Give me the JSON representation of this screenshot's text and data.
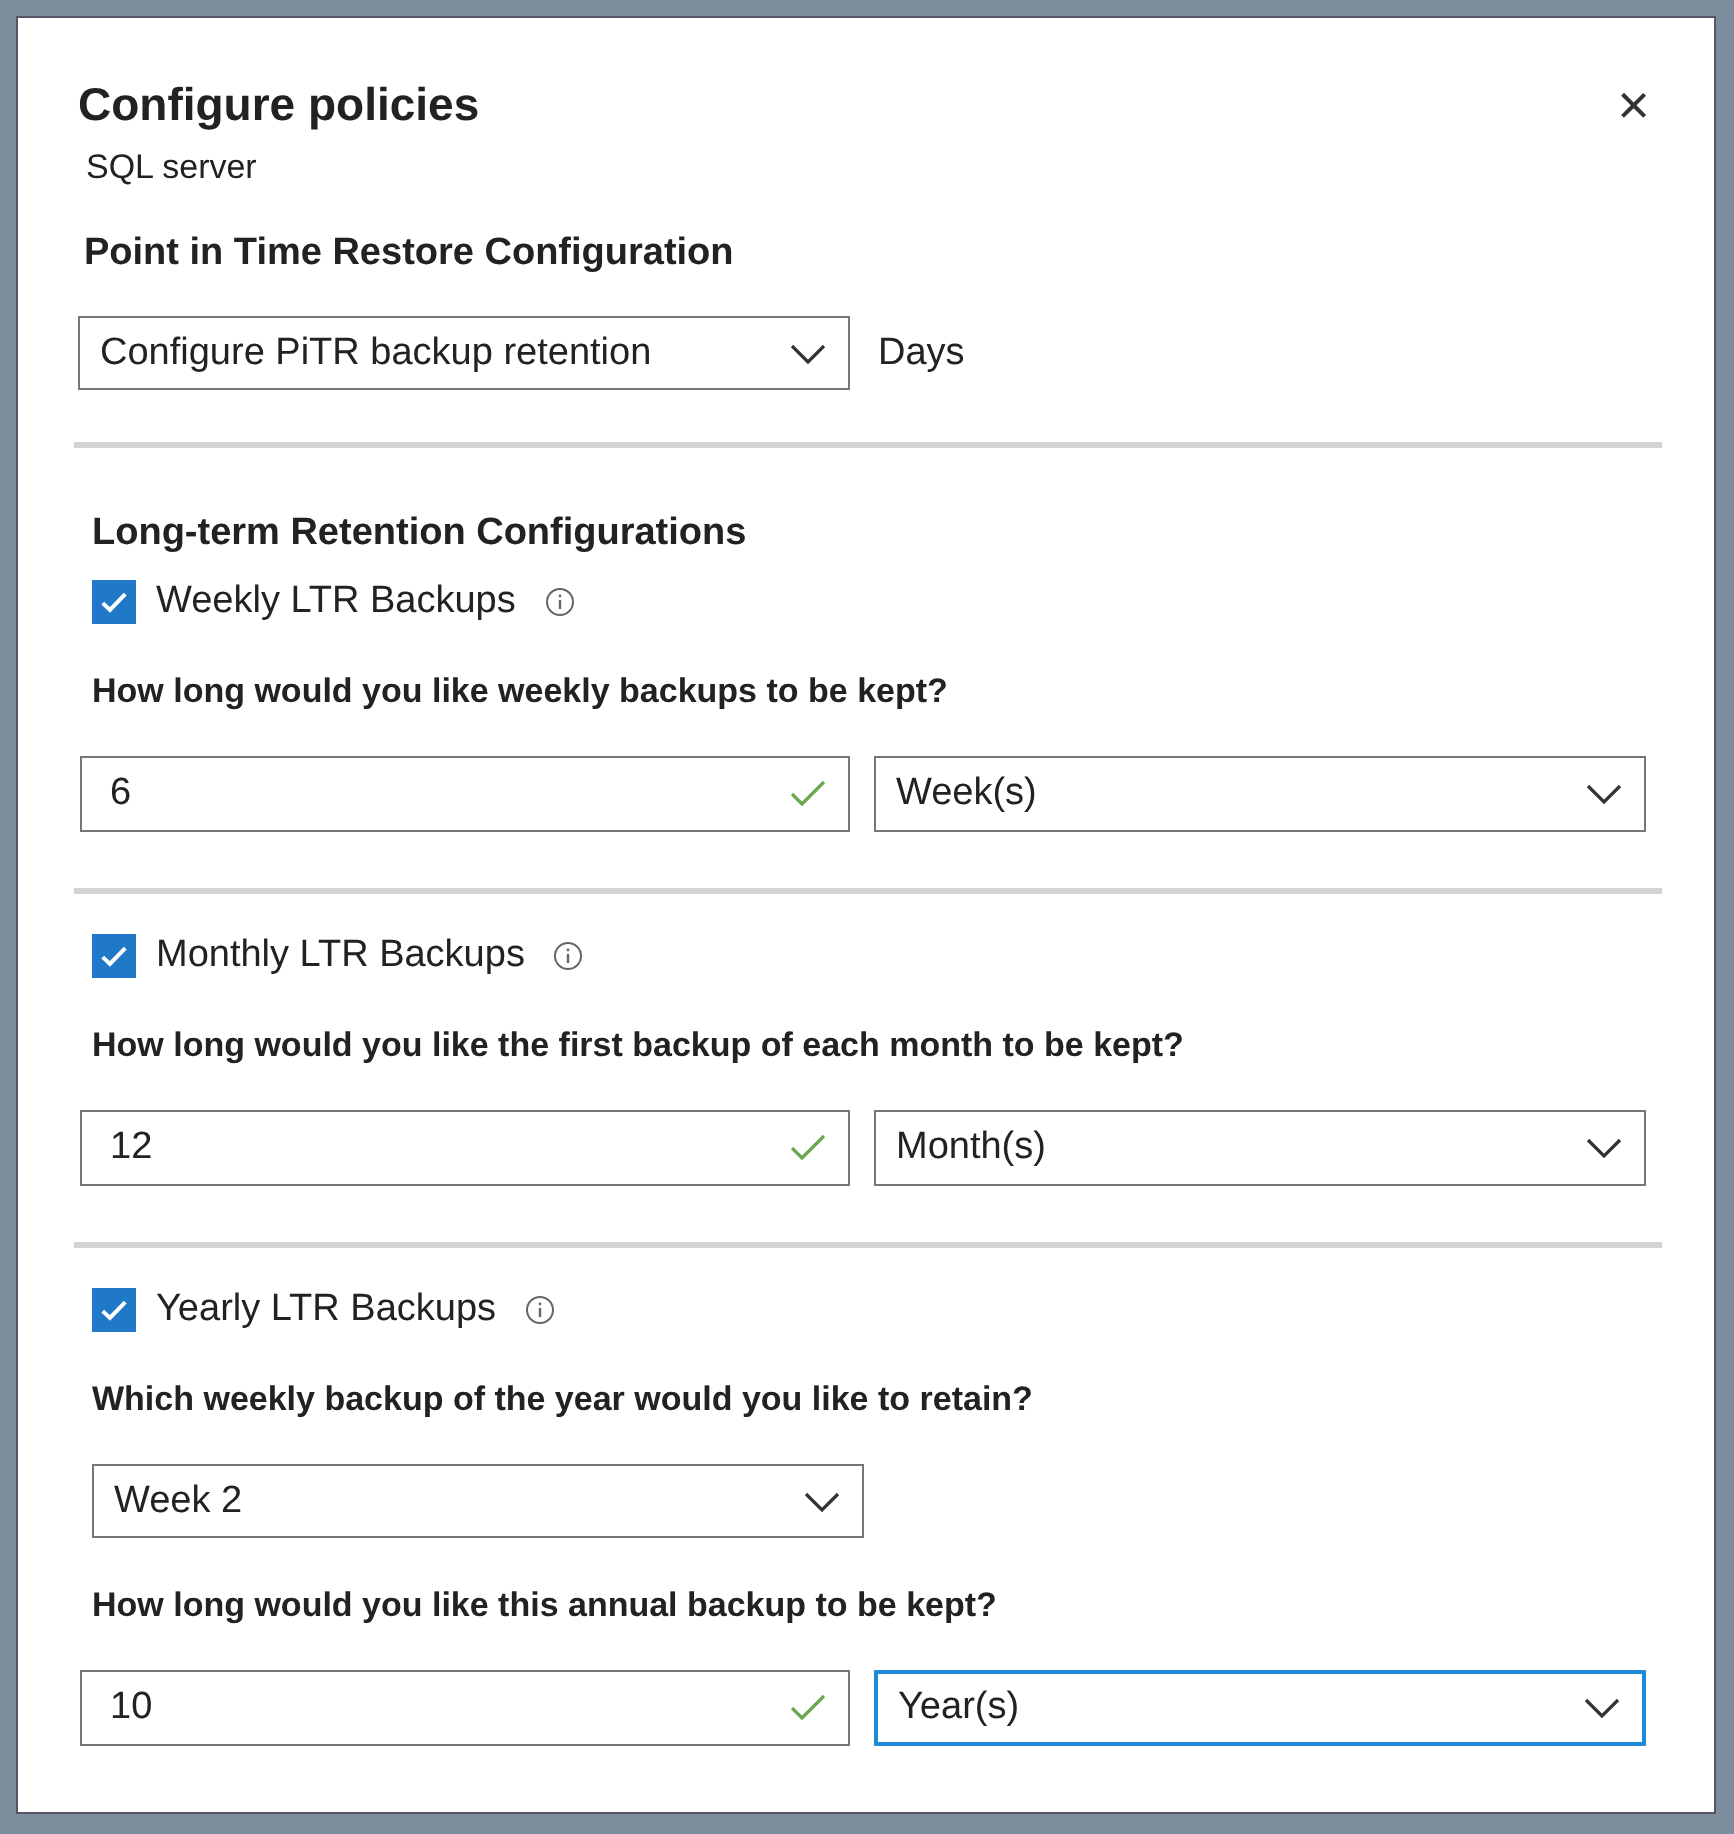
{
  "panel": {
    "title": "Configure policies",
    "subtitle": "SQL server",
    "close": "×"
  },
  "pitr": {
    "heading": "Point in Time Restore Configuration",
    "dropdown": "Configure PiTR backup retention",
    "unit": "Days"
  },
  "ltr_heading": "Long-term Retention Configurations",
  "sections": [
    {
      "label": "Weekly LTR Backups",
      "checked": true,
      "rows": [
        {
          "kind": "question",
          "text": "How long would you like weekly backups to be kept?"
        },
        {
          "kind": "amount",
          "value": "6",
          "valid": true,
          "unit": "Week(s)",
          "focused": false
        }
      ]
    },
    {
      "label": "Monthly LTR Backups",
      "checked": true,
      "rows": [
        {
          "kind": "question",
          "text": "How long would you like the first backup of each month to be kept?"
        },
        {
          "kind": "amount",
          "value": "12",
          "valid": true,
          "unit": "Month(s)",
          "focused": false
        }
      ]
    },
    {
      "label": "Yearly LTR Backups",
      "checked": true,
      "rows": [
        {
          "kind": "question",
          "text": "Which weekly backup of the year would you like to retain?"
        },
        {
          "kind": "select",
          "value": "Week 2"
        },
        {
          "kind": "question",
          "text": "How long would you like this annual backup to be kept?"
        },
        {
          "kind": "amount",
          "value": "10",
          "valid": true,
          "unit": "Year(s)",
          "focused": true
        }
      ]
    }
  ]
}
